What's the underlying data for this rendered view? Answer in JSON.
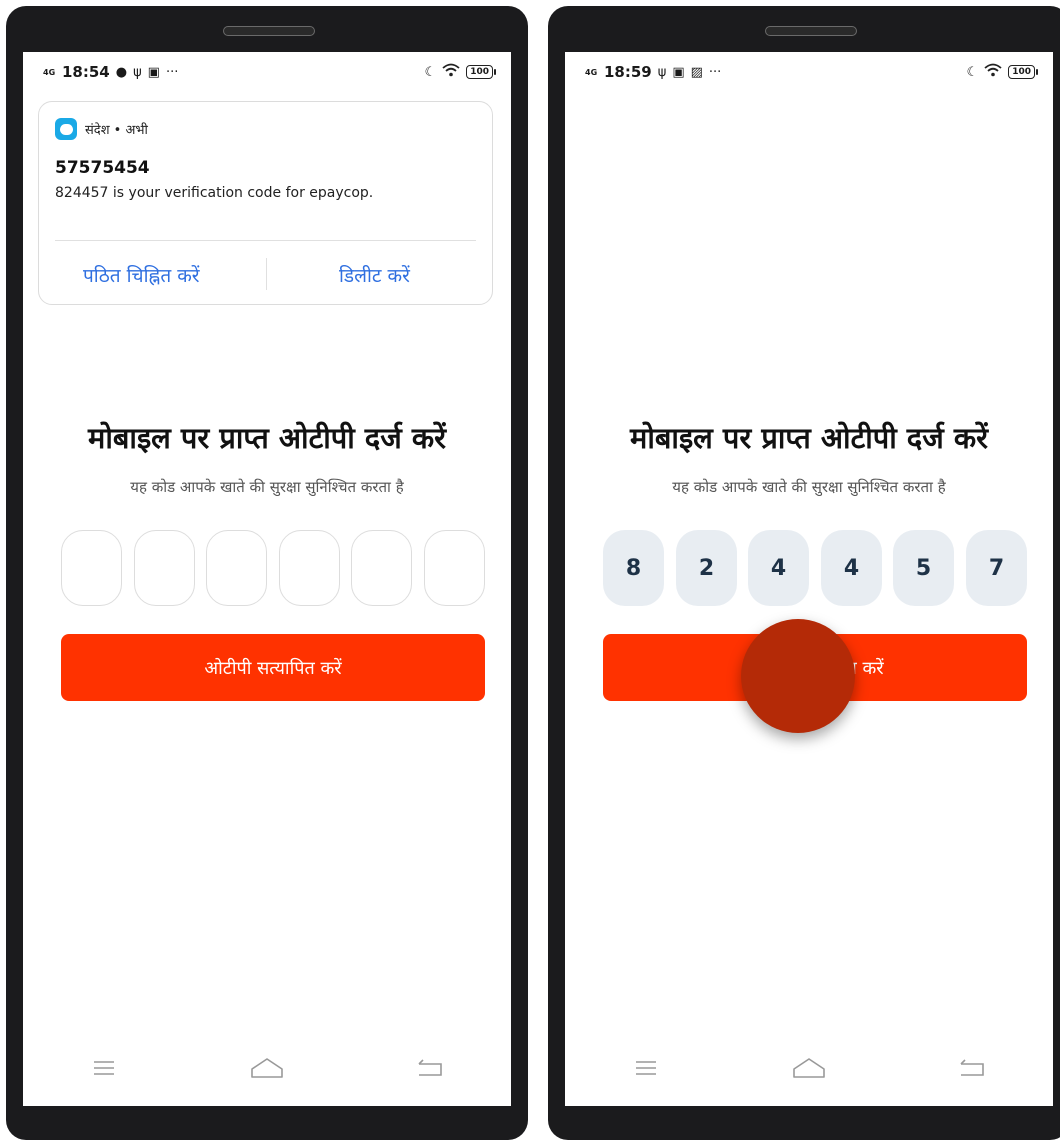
{
  "left_screen": {
    "status_bar": {
      "network": "4G",
      "time": "18:54",
      "battery": "100"
    },
    "notification": {
      "app_name": "संदेश • अभी",
      "sender": "57575454",
      "message": "824457 is your verification code for epaycop.",
      "action_mark_read": "पठित चिह्नित करें",
      "action_delete": "डिलीट करें"
    },
    "title": "मोबाइल पर प्राप्त ओटीपी दर्ज करें",
    "subtitle": "यह कोड आपके खाते की सुरक्षा सुनिश्चित करता है",
    "otp_digits": [
      "",
      "",
      "",
      "",
      "",
      ""
    ],
    "verify_button": "ओटीपी सत्यापित करें"
  },
  "right_screen": {
    "status_bar": {
      "network": "4G",
      "time": "18:59",
      "battery": "100"
    },
    "title": "मोबाइल पर प्राप्त ओटीपी दर्ज करें",
    "subtitle": "यह कोड आपके खाते की सुरक्षा सुनिश्चित करता है",
    "otp_digits": [
      "8",
      "2",
      "4",
      "4",
      "5",
      "7"
    ],
    "verify_button": "ओटीपी सत्यापित करें"
  },
  "colors": {
    "accent": "#ff3200",
    "link": "#2f6fe0",
    "otp_filled_bg": "#e8edf2",
    "touch_indicator": "#b42a07"
  }
}
